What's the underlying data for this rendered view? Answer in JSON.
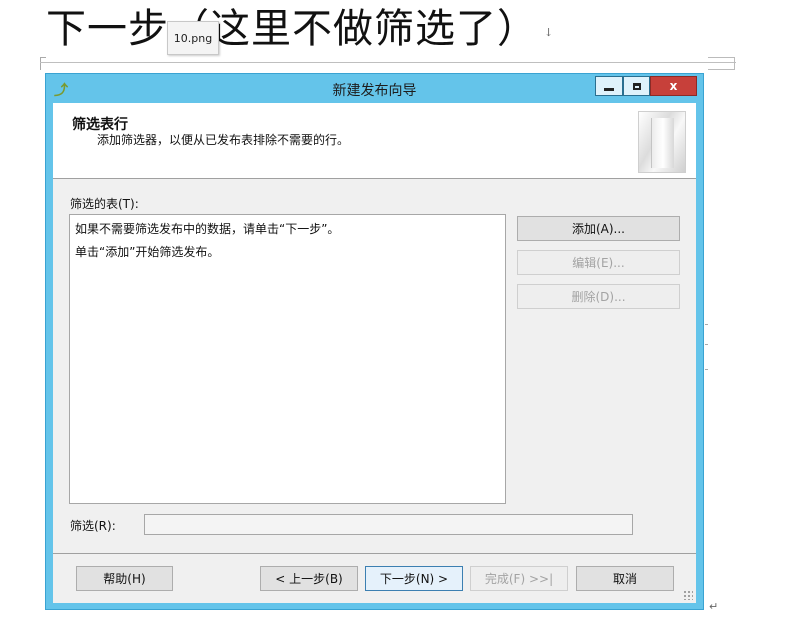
{
  "document": {
    "heading": "下一步（这里不做筛选了）",
    "paragraph_mark": "↓",
    "end_mark": "↵",
    "image_tooltip": "10.png"
  },
  "window": {
    "title": "新建发布向导",
    "icon": "wizard-icon",
    "controls": {
      "close": "x"
    }
  },
  "page": {
    "title": "筛选表行",
    "description": "添加筛选器，以便从已发布表排除不需要的行。"
  },
  "tables": {
    "label": "筛选的表(T):",
    "lines": [
      "如果不需要筛选发布中的数据，请单击“下一步”。",
      "单击“添加”开始筛选发布。"
    ]
  },
  "side_buttons": {
    "add": "添加(A)...",
    "edit": "编辑(E)...",
    "delete": "删除(D)..."
  },
  "filter": {
    "label": "筛选(R):",
    "value": ""
  },
  "footer": {
    "help": "帮助(H)",
    "back": "< 上一步(B)",
    "next": "下一步(N) >",
    "finish": "完成(F) >>|",
    "cancel": "取消"
  },
  "colors": {
    "window_frame": "#64c4ea",
    "close_button": "#c7403a",
    "dialog_bg": "#f0f0f0"
  }
}
